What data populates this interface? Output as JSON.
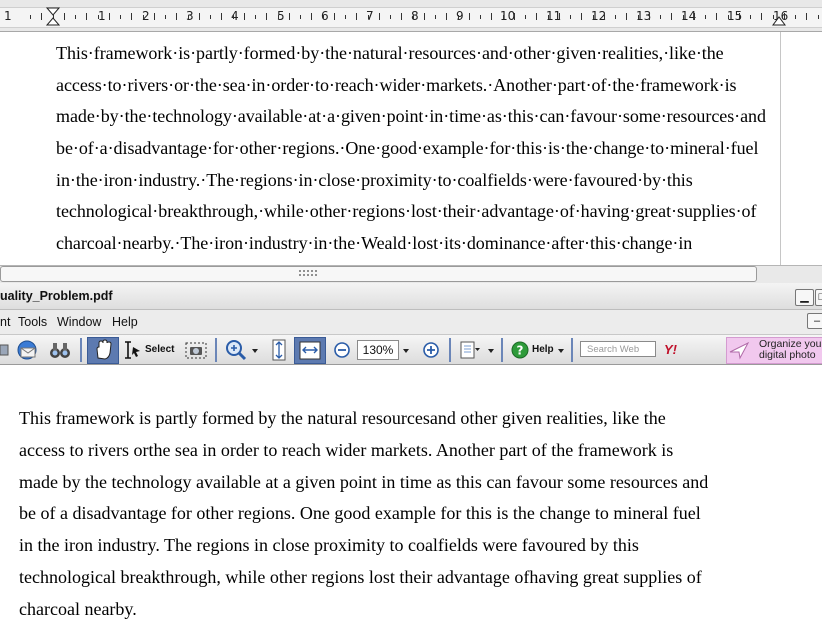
{
  "writer": {
    "ruler_numbers": [
      "1",
      "1",
      "2",
      "3",
      "4",
      "5",
      "6",
      "7",
      "8",
      "9",
      "10",
      "11",
      "12",
      "13",
      "14",
      "15",
      "16"
    ],
    "paragraph_lines": [
      "This·framework·is·partly·formed·by·the·natural·resources·and·other·given·realities,·like·the",
      "access·to·rivers·or·the·sea·in·order·to·reach·wider·markets.·Another·part·of·the·framework·is",
      "made·by·the·technology·available·at·a·given·point·in·time·as·this·can·favour·some·resources·and",
      "be·of·a·disadvantage·for·other·regions.·One·good·example·for·this·is·the·change·to·mineral·fuel",
      "in·the·iron·industry.·The·regions·in·close·proximity·to·coalfields·were·favoured·by·this",
      "technological·breakthrough,·while·other·regions·lost·their·advantage·of·having·great·supplies·of",
      "charcoal·nearby.·The·iron·industry·in·the·Weald·lost·its·dominance·after·this·change·in"
    ]
  },
  "pdf_window": {
    "title": "uality_Problem.pdf",
    "menu": [
      "nt",
      "Tools",
      "Window",
      "Help"
    ],
    "toolbar": {
      "select_label": "Select",
      "zoom_value": "130%",
      "help_label": "Help",
      "search_placeholder": "Search Web",
      "yahoo_label": "Y!",
      "promo_line1": "Organize you",
      "promo_line2": "digital photo"
    },
    "page_lines": [
      "This framework is partly formed by the natural resourcesand other given realities, like the",
      "access to rivers orthe sea in order to reach wider markets. Another part of the framework is",
      "made by the technology available at a given point in time as this can favour some resources and",
      "be of a disadvantage for other regions. One good example for this is the change to mineral fuel",
      "in the iron industry. The regions in close proximity to coalfields were favoured by this",
      "technological breakthrough, while other regions lost their advantage ofhaving great supplies of",
      "charcoal nearby."
    ]
  },
  "colors": {
    "toolbar_separator": "#6b86b8",
    "pressed_tool": "#5d7ab0",
    "promo_background": "#f1c8ee"
  }
}
